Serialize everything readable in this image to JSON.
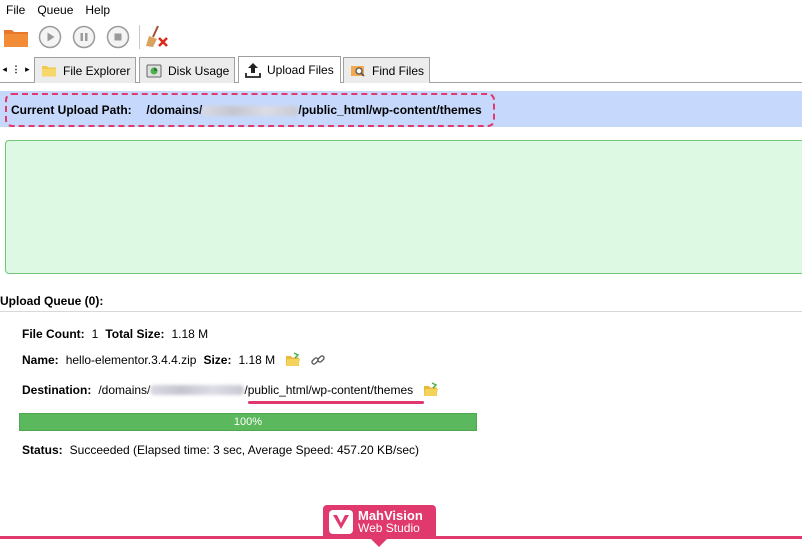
{
  "menu": [
    "File",
    "Queue",
    "Help"
  ],
  "tabs": [
    {
      "label": "File Explorer",
      "icon": "folder-icon"
    },
    {
      "label": "Disk Usage",
      "icon": "disk-usage-icon"
    },
    {
      "label": "Upload Files",
      "icon": "upload-icon"
    },
    {
      "label": "Find Files",
      "icon": "find-files-icon"
    }
  ],
  "active_tab": "Upload Files",
  "upload_path": {
    "label": "Current Upload Path:",
    "prefix": "/domains/",
    "suffix": "/public_html/wp-content/themes"
  },
  "queue": {
    "header": "Upload Queue (0):",
    "file_count_label": "File Count:",
    "file_count": "1",
    "total_size_label": "Total Size:",
    "total_size": "1.18 M",
    "name_label": "Name:",
    "name": "hello-elementor.3.4.4.zip",
    "size_label": "Size:",
    "size": "1.18 M",
    "destination_label": "Destination:",
    "destination_prefix": "/domains/",
    "destination_suffix": "/public_html/wp-content/themes",
    "progress_text": "100%",
    "progress": 1.0,
    "status_label": "Status:",
    "status": "Succeeded (Elapsed time: 3 sec, Average Speed: 457.20 KB/sec)"
  },
  "watermark": {
    "line1": "MahVision",
    "line2": "Web Studio"
  },
  "colors": {
    "accent": "#e0396e",
    "path_bar": "#c6d9fc",
    "drop_zone": "#ddf9e3",
    "progress": "#5cb85c"
  }
}
